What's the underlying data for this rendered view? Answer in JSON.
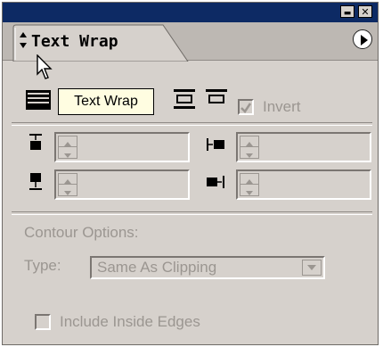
{
  "window": {
    "minimize_label": "▬",
    "close_label": "✕"
  },
  "tab": {
    "title": "Text Wrap",
    "menu_icon": "play-circle-icon"
  },
  "wrap_options": {
    "tooltip": "Text Wrap",
    "invert_label": "Invert",
    "invert_checked": true
  },
  "offsets": {
    "top_icon": "top-offset-icon",
    "bottom_icon": "bottom-offset-icon",
    "left_icon": "left-offset-icon",
    "right_icon": "right-offset-icon"
  },
  "contour": {
    "section_label": "Contour Options:",
    "type_label": "Type:",
    "type_value": "Same As Clipping",
    "include_inside_edges_label": "Include Inside Edges",
    "include_inside_edges_checked": false
  },
  "colors": {
    "title_bar": "#0d2a64",
    "panel_bg": "#d6d1cc",
    "tooltip_bg": "#fffde1",
    "disabled_text": "#9b9691"
  }
}
